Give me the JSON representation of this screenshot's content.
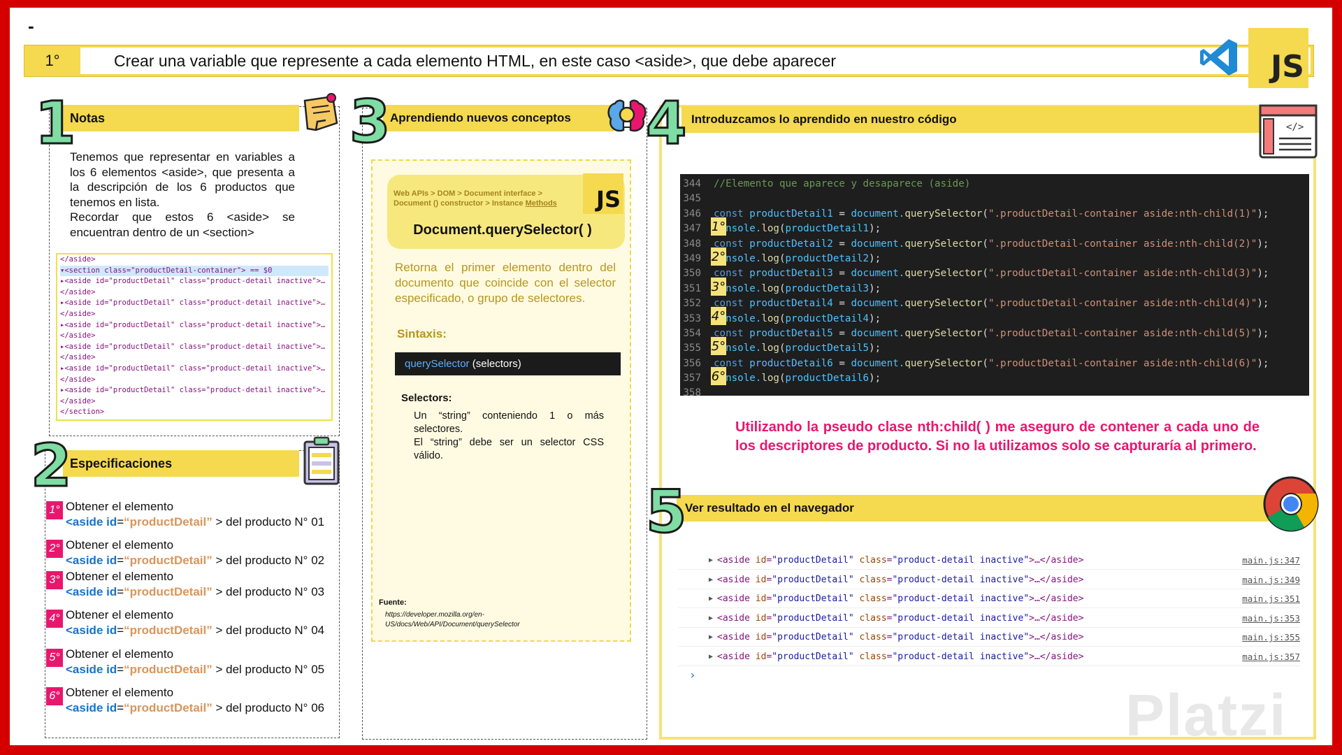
{
  "header": {
    "dash": "-",
    "step": "1°",
    "title": "Crear una variable que represente a cada elemento HTML, en este caso <aside>, que debe aparecer",
    "logo_text": "JS"
  },
  "section1": {
    "number": "1",
    "title": "Notas",
    "paragraphs": [
      "Tenemos que representar en variables a los 6 elementos <aside>, que presenta a la descripción de los 6 productos que tenemos en lista.",
      "Recordar que estos 6 <aside> se encuentran dentro de un <section>"
    ],
    "devtools_lines": [
      "</aside>",
      "▾<section class=\"productDetail-container\"> == $0",
      "  ▸<aside id=\"productDetail\" class=\"product-detail inactive\">…",
      "   </aside>",
      "  ▸<aside id=\"productDetail\" class=\"product-detail inactive\">…",
      "   </aside>",
      "  ▸<aside id=\"productDetail\" class=\"product-detail inactive\">…",
      "   </aside>",
      "  ▸<aside id=\"productDetail\" class=\"product-detail inactive\">…",
      "   </aside>",
      "  ▸<aside id=\"productDetail\" class=\"product-detail inactive\">…",
      "   </aside>",
      "  ▸<aside id=\"productDetail\" class=\"product-detail inactive\">…",
      "   </aside>",
      " </section>"
    ]
  },
  "section2": {
    "number": "2",
    "title": "Especificaciones",
    "items": [
      {
        "badge": "1°",
        "line1": "Obtener el elemento",
        "open": "<aside",
        "attr": "id",
        "eq": "=",
        "val": "“productDetail”",
        "rest": "> del producto N° 01"
      },
      {
        "badge": "2°",
        "line1": "Obtener el elemento",
        "open": "<aside",
        "attr": "id",
        "eq": "=",
        "val": "“productDetail”",
        "rest": "> del producto N° 02"
      },
      {
        "badge": "3°",
        "line1": "Obtener el elemento",
        "open": "<aside",
        "attr": "id",
        "eq": "=",
        "val": "“productDetail”",
        "rest": "> del producto N° 03"
      },
      {
        "badge": "4°",
        "line1": "Obtener el elemento",
        "open": "<aside",
        "attr": "id",
        "eq": "=",
        "val": "“productDetail”",
        "rest": "> del producto N° 04"
      },
      {
        "badge": "5°",
        "line1": "Obtener el elemento",
        "open": "<aside",
        "attr": "id",
        "eq": "=",
        "val": "“productDetail”",
        "rest": "> del producto N° 05"
      },
      {
        "badge": "6°",
        "line1": "Obtener el elemento",
        "open": "<aside",
        "attr": "id",
        "eq": "=",
        "val": "“productDetail”",
        "rest": "> del producto N° 06"
      }
    ]
  },
  "section3": {
    "number": "3",
    "title": "Aprendiendo nuevos conceptos",
    "breadcrumb_line1": "Web APIs  >  DOM  >  Document interface  >",
    "breadcrumb_line2": "Document () constructor > Instance ",
    "breadcrumb_link": "Methods",
    "card_logo": "JS",
    "card_title": "Document.querySelector( )",
    "description": "Retorna el primer elemento dentro del documento que coincide con el selector especificado, o grupo de selectores.",
    "syntax_label": "Sintaxis:",
    "syntax_fn": "querySelector",
    "syntax_args": " (selectors)",
    "selectors_label": "Selectors:",
    "selectors_text": "Un “string” conteniendo 1 o más selectores.",
    "selectors_text2": "El “string” debe ser un selector CSS válido.",
    "source_label": "Fuente:",
    "source_url": "https://developer.mozilla.org/en-US/docs/Web/API/Document/querySelector"
  },
  "section4": {
    "number": "4",
    "title": "Introduzcamos lo aprendido en nuestro código",
    "comment_line": {
      "n": "344",
      "text": "//Elemento que aparece y desaparece (aside)"
    },
    "blank_line": "345",
    "pairs": [
      {
        "badge": "1°",
        "n1": "346",
        "var": "productDetail1",
        "arg": "\".productDetail-container aside:nth-child(1)\"",
        "n2": "347"
      },
      {
        "badge": "2°",
        "n1": "348",
        "var": "productDetail2",
        "arg": "\".productDetail-container aside:nth-child(2)\"",
        "n2": "349"
      },
      {
        "badge": "3°",
        "n1": "350",
        "var": "productDetail3",
        "arg": "\".productDetail-container aside:nth-child(3)\"",
        "n2": "351"
      },
      {
        "badge": "4°",
        "n1": "352",
        "var": "productDetail4",
        "arg": "\".productDetail-container aside:nth-child(4)\"",
        "n2": "353"
      },
      {
        "badge": "5°",
        "n1": "354",
        "var": "productDetail5",
        "arg": "\".productDetail-container aside:nth-child(5)\"",
        "n2": "355"
      },
      {
        "badge": "6°",
        "n1": "356",
        "var": "productDetail6",
        "arg": "\".productDetail-container aside:nth-child(6)\"",
        "n2": "357"
      }
    ],
    "last_line": "358",
    "kw_const": "const",
    "eq": " = ",
    "doc_call": "document.",
    "fn": "querySelector",
    "console_call": "console.",
    "log_fn": "log",
    "note": "Utilizando la pseudo clase nth:child( ) me aseguro de contener a cada uno de los descriptores de producto. Si no la utilizamos solo se capturaría al primero."
  },
  "section5": {
    "number": "5",
    "title": "Ver resultado en el navegador",
    "rows": [
      {
        "src": "main.js:347"
      },
      {
        "src": "main.js:349"
      },
      {
        "src": "main.js:351"
      },
      {
        "src": "main.js:353"
      },
      {
        "src": "main.js:355"
      },
      {
        "src": "main.js:357"
      }
    ],
    "row_open": "<aside ",
    "row_attr1": "id",
    "row_val1": "\"productDetail\"",
    "row_attr2": " class",
    "row_val2": "\"product-detail inactive\"",
    "row_close": ">…</aside>",
    "prompt": "›"
  },
  "watermark": "Platzi",
  "colors": {
    "frame": "#d40000",
    "yellow": "#f5d94e",
    "pink": "#e8176e",
    "green": "#7fdda4"
  }
}
